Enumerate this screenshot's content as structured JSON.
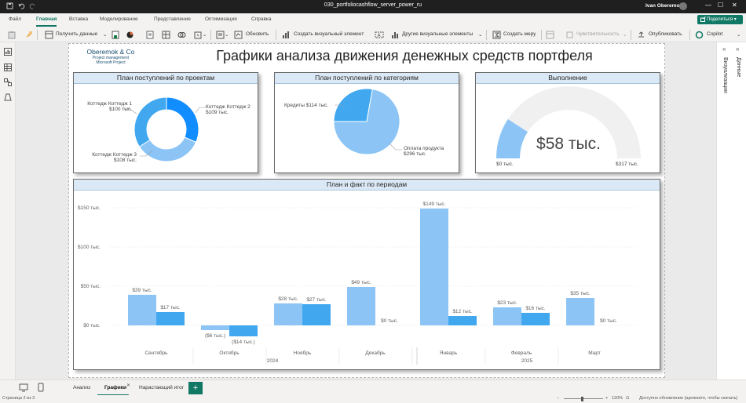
{
  "window": {
    "doc_title": "030_portfoliocashflow_server_power_ru",
    "user_name": "Ivan Oberemok"
  },
  "menu": {
    "tabs": [
      "Файл",
      "Главная",
      "Вставка",
      "Моделирование",
      "Представление",
      "Оптимизация",
      "Справка"
    ],
    "share": "Поделиться"
  },
  "ribbon": {
    "get_data": "Получить данные",
    "refresh": "Обновить",
    "new_visual": "Создать визуальный элемент",
    "more_visuals": "Другие визуальные элементы",
    "new_measure": "Создать меру",
    "sensitivity": "Чувствительность",
    "publish": "Опубликовать",
    "copilot": "Copilot"
  },
  "side_panes": {
    "visualizations": "Визуализации",
    "data": "Данные"
  },
  "report": {
    "logo_name": "Oberemok & Co",
    "logo_sub1": "Project management",
    "logo_sub2": "Microsoft Project",
    "title": "Графики анализа движения денежных средств портфеля"
  },
  "cards": {
    "projects": {
      "title": "План поступлений по проектам",
      "labels": [
        {
          "l1": "Коттедж Коттедж 1",
          "l2": "$100 тыс."
        },
        {
          "l1": "Коттедж Коттедж 2",
          "l2": "$109 тыс."
        },
        {
          "l1": "Коттедж Коттедж 3",
          "l2": "$108 тыс."
        }
      ]
    },
    "categories": {
      "title": "План поступлений по категориям",
      "credit": "Кредиты $114 тыс.",
      "payment_l1": "Оплата продукта",
      "payment_l2": "$296 тыс."
    },
    "gauge": {
      "title": "Выполнение",
      "value": "$58 тыс.",
      "min": "$0 тыс.",
      "max": "$317 тыс."
    },
    "periods": {
      "title": "План и факт по периодам"
    }
  },
  "colors": {
    "dark_blue": "#118DFF",
    "mid_blue": "#41A8F0",
    "light_blue": "#8BC4F5",
    "gauge_track": "#F0F0F0",
    "accent_green": "#117865"
  },
  "chart_data": [
    {
      "type": "pie",
      "variant": "donut",
      "title": "План поступлений по проектам",
      "categories": [
        "Коттедж Коттедж 1",
        "Коттедж Коттедж 2",
        "Коттедж Коттедж 3"
      ],
      "values": [
        100,
        109,
        108
      ],
      "value_labels": [
        "$100 тыс.",
        "$109 тыс.",
        "$108 тыс."
      ],
      "unit": "тыс. $"
    },
    {
      "type": "pie",
      "title": "План поступлений по категориям",
      "categories": [
        "Кредиты",
        "Оплата продукта"
      ],
      "values": [
        114,
        296
      ],
      "value_labels": [
        "$114 тыс.",
        "$296 тыс."
      ],
      "unit": "тыс. $"
    },
    {
      "type": "gauge",
      "title": "Выполнение",
      "value": 58,
      "min": 0,
      "max": 317,
      "unit": "тыс. $"
    },
    {
      "type": "bar",
      "title": "План и факт по периодам",
      "categories": [
        "Сентябрь",
        "Октябрь",
        "Ноябрь",
        "Декабрь",
        "Январь",
        "Февраль",
        "Март"
      ],
      "year_labels": [
        "2024",
        "2025"
      ],
      "series": [
        {
          "values": [
            39,
            -6,
            28,
            49,
            149,
            23,
            35
          ],
          "labels": [
            "$39 тыс.",
            "($6 тыс.)",
            "$28 тыс.",
            "$49 тыс.",
            "$149 тыс.",
            "$23 тыс.",
            "$35 тыс."
          ]
        },
        {
          "values": [
            17,
            -14,
            27,
            0,
            12,
            16,
            0
          ],
          "labels": [
            "$17 тыс.",
            "($14 тыс.)",
            "$27 тыс.",
            "$0 тыс.",
            "$12 тыс.",
            "$16 тыс.",
            "$0 тыс."
          ]
        }
      ],
      "y_ticks": [
        "$0 тыс.",
        "$50 тыс.",
        "$100 тыс.",
        "$150 тыс."
      ],
      "y_tick_values": [
        0,
        50,
        100,
        150
      ],
      "ylim": [
        -20,
        160
      ],
      "grid": true
    }
  ],
  "pages": {
    "tabs": [
      "Анализ",
      "Графики",
      "Нарастающий итог"
    ],
    "active": "Графики"
  },
  "status": {
    "page_info": "Страница 2 из 3",
    "zoom": "120%",
    "update": "Доступно обновление (щелкните, чтобы скачать)"
  }
}
